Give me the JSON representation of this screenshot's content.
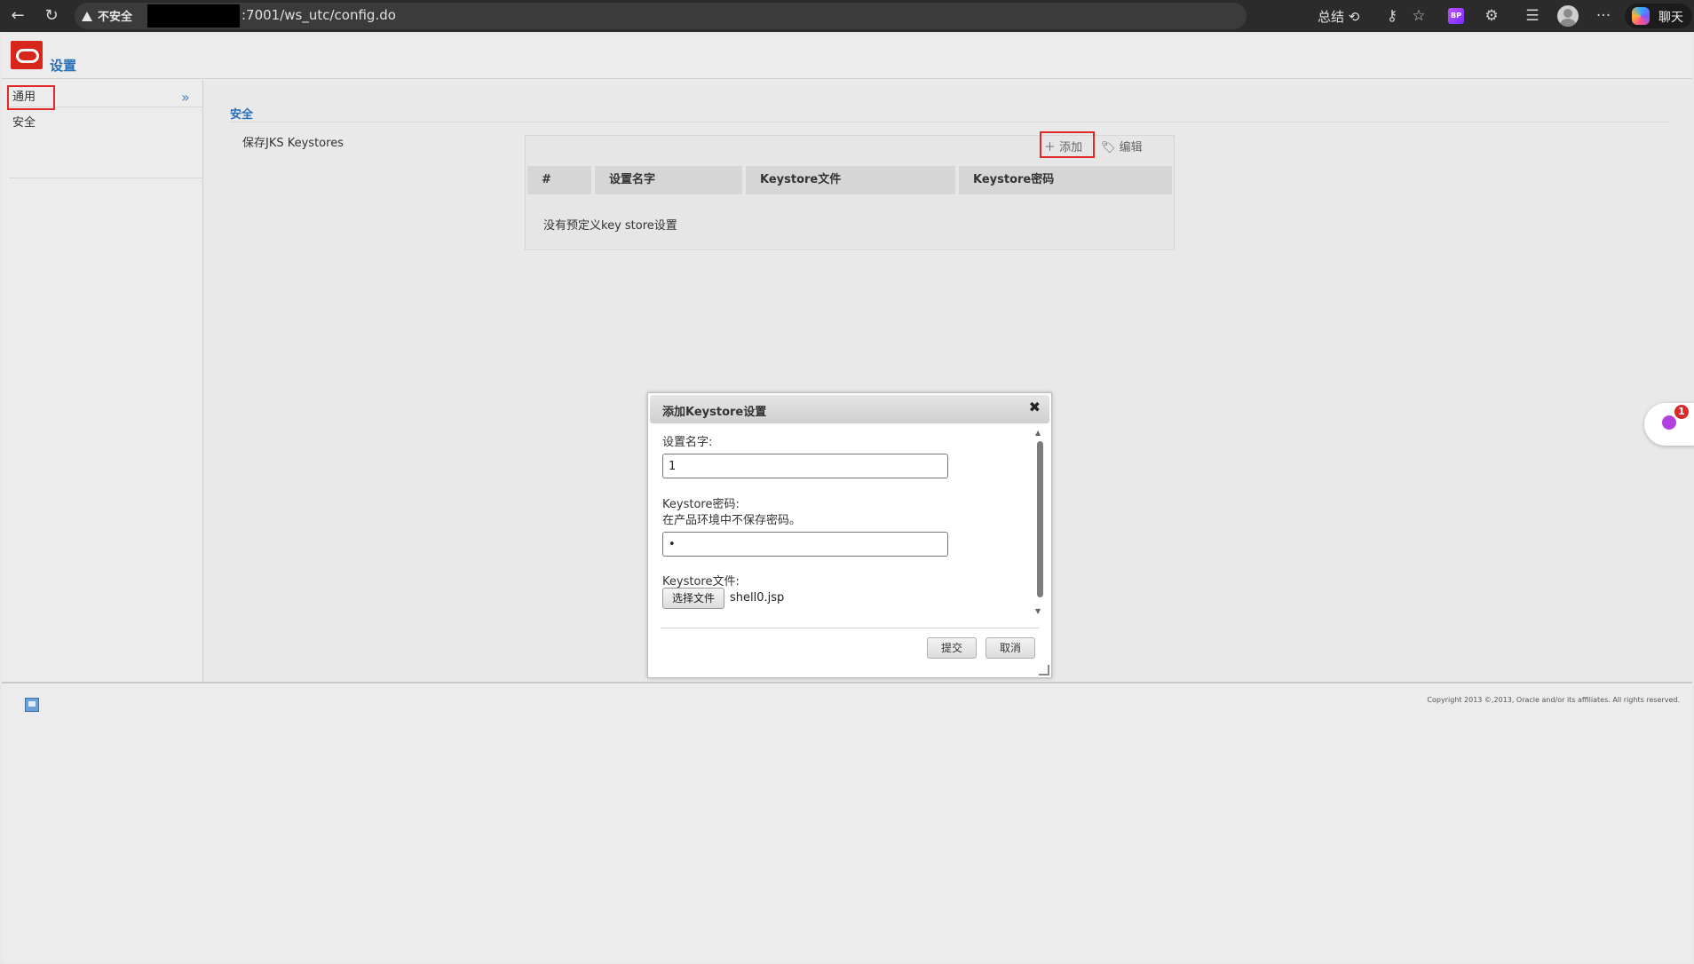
{
  "browser": {
    "security_label": "不安全",
    "url": ":7001/ws_utc/config.do",
    "summary_label": "总结",
    "extension_badge": "BP",
    "chat_label": "聊天",
    "more": "···"
  },
  "header": {
    "title": "设置"
  },
  "sidebar": {
    "items": [
      {
        "label": "通用"
      },
      {
        "label": "安全"
      }
    ],
    "expand_icon": "»"
  },
  "main": {
    "section_title": "安全",
    "keystore_label": "保存JKS Keystores",
    "toolbar": {
      "add_label": "添加",
      "edit_label": "编辑"
    },
    "table": {
      "columns": [
        "#",
        "设置名字",
        "Keystore文件",
        "Keystore密码"
      ],
      "empty_text": "没有预定义key store设置"
    }
  },
  "dialog": {
    "title": "添加Keystore设置",
    "close": "✖",
    "name_label": "设置名字:",
    "name_value": "1",
    "password_label": "Keystore密码:",
    "password_hint": "在产品环境中不保存密码。",
    "password_value": "•",
    "file_label": "Keystore文件:",
    "file_button": "选择文件",
    "file_name": "shell0.jsp",
    "submit_label": "提交",
    "cancel_label": "取消"
  },
  "footer": {
    "copyright": "Copyright 2013 ©,2013, Oracle and/or its affiliates. All rights reserved."
  },
  "widget": {
    "badge_count": "1"
  },
  "colors": {
    "accent": "#2a6fb6",
    "brand": "#d9261c",
    "highlight": "#e22727"
  }
}
